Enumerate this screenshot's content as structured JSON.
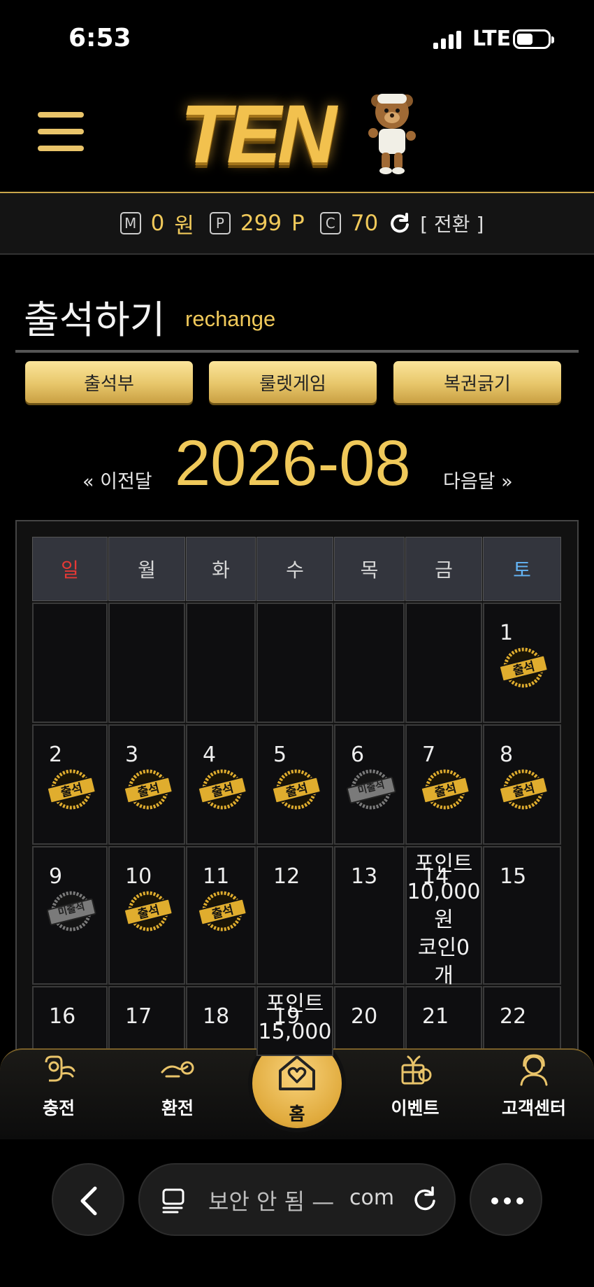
{
  "status_bar": {
    "time": "6:53",
    "network": "LTE"
  },
  "balance": {
    "money_icon": "M",
    "money_value": "0",
    "money_unit": "원",
    "point_icon": "P",
    "point_value": "299",
    "point_unit": "P",
    "coin_icon": "C",
    "coin_value": "70",
    "switch_label": "[ 전환 ]"
  },
  "page": {
    "title": "출석하기",
    "subtitle": "rechange"
  },
  "tabs": [
    "출석부",
    "룰렛게임",
    "복권긁기"
  ],
  "month_nav": {
    "prev": "« 이전달",
    "current": "2026-08",
    "next": "다음달 »"
  },
  "weekdays": [
    {
      "label": "일",
      "color": "#e53935"
    },
    {
      "label": "월",
      "color": "#d7d7d7"
    },
    {
      "label": "화",
      "color": "#d7d7d7"
    },
    {
      "label": "수",
      "color": "#d7d7d7"
    },
    {
      "label": "목",
      "color": "#d7d7d7"
    },
    {
      "label": "금",
      "color": "#d7d7d7"
    },
    {
      "label": "토",
      "color": "#64b5f6"
    }
  ],
  "stamps": {
    "attended": "출석",
    "absent": "미출석"
  },
  "days": [
    {
      "day": "1",
      "status": "attended"
    },
    {
      "day": "2",
      "status": "attended"
    },
    {
      "day": "3",
      "status": "attended"
    },
    {
      "day": "4",
      "status": "attended"
    },
    {
      "day": "5",
      "status": "attended"
    },
    {
      "day": "6",
      "status": "absent"
    },
    {
      "day": "7",
      "status": "attended"
    },
    {
      "day": "8",
      "status": "attended"
    },
    {
      "day": "9",
      "status": "absent"
    },
    {
      "day": "10",
      "status": "attended"
    },
    {
      "day": "11",
      "status": "attended"
    },
    {
      "day": "12",
      "status": ""
    },
    {
      "day": "13",
      "status": ""
    },
    {
      "day": "14",
      "status": "",
      "note": [
        "포인트",
        "10,000",
        "원",
        "코인0",
        "개"
      ]
    },
    {
      "day": "15",
      "status": ""
    },
    {
      "day": "16",
      "status": ""
    },
    {
      "day": "17",
      "status": ""
    },
    {
      "day": "18",
      "status": ""
    },
    {
      "day": "19",
      "status": "",
      "note": [
        "포인트",
        "15,000"
      ]
    },
    {
      "day": "20",
      "status": ""
    },
    {
      "day": "21",
      "status": ""
    },
    {
      "day": "22",
      "status": ""
    }
  ],
  "bottom_nav": [
    {
      "label": "충전",
      "icon": "charge-icon"
    },
    {
      "label": "환전",
      "icon": "exchange-icon"
    },
    {
      "label": "홈",
      "icon": "home-heart-icon"
    },
    {
      "label": "이벤트",
      "icon": "gift-icon"
    },
    {
      "label": "고객센터",
      "icon": "support-icon"
    }
  ],
  "browser": {
    "url_status": "보안 안 됨 —",
    "url_domain": "com"
  },
  "colors": {
    "gold": "#f0c95a",
    "sunday": "#e53935",
    "saturday": "#64b5f6"
  }
}
